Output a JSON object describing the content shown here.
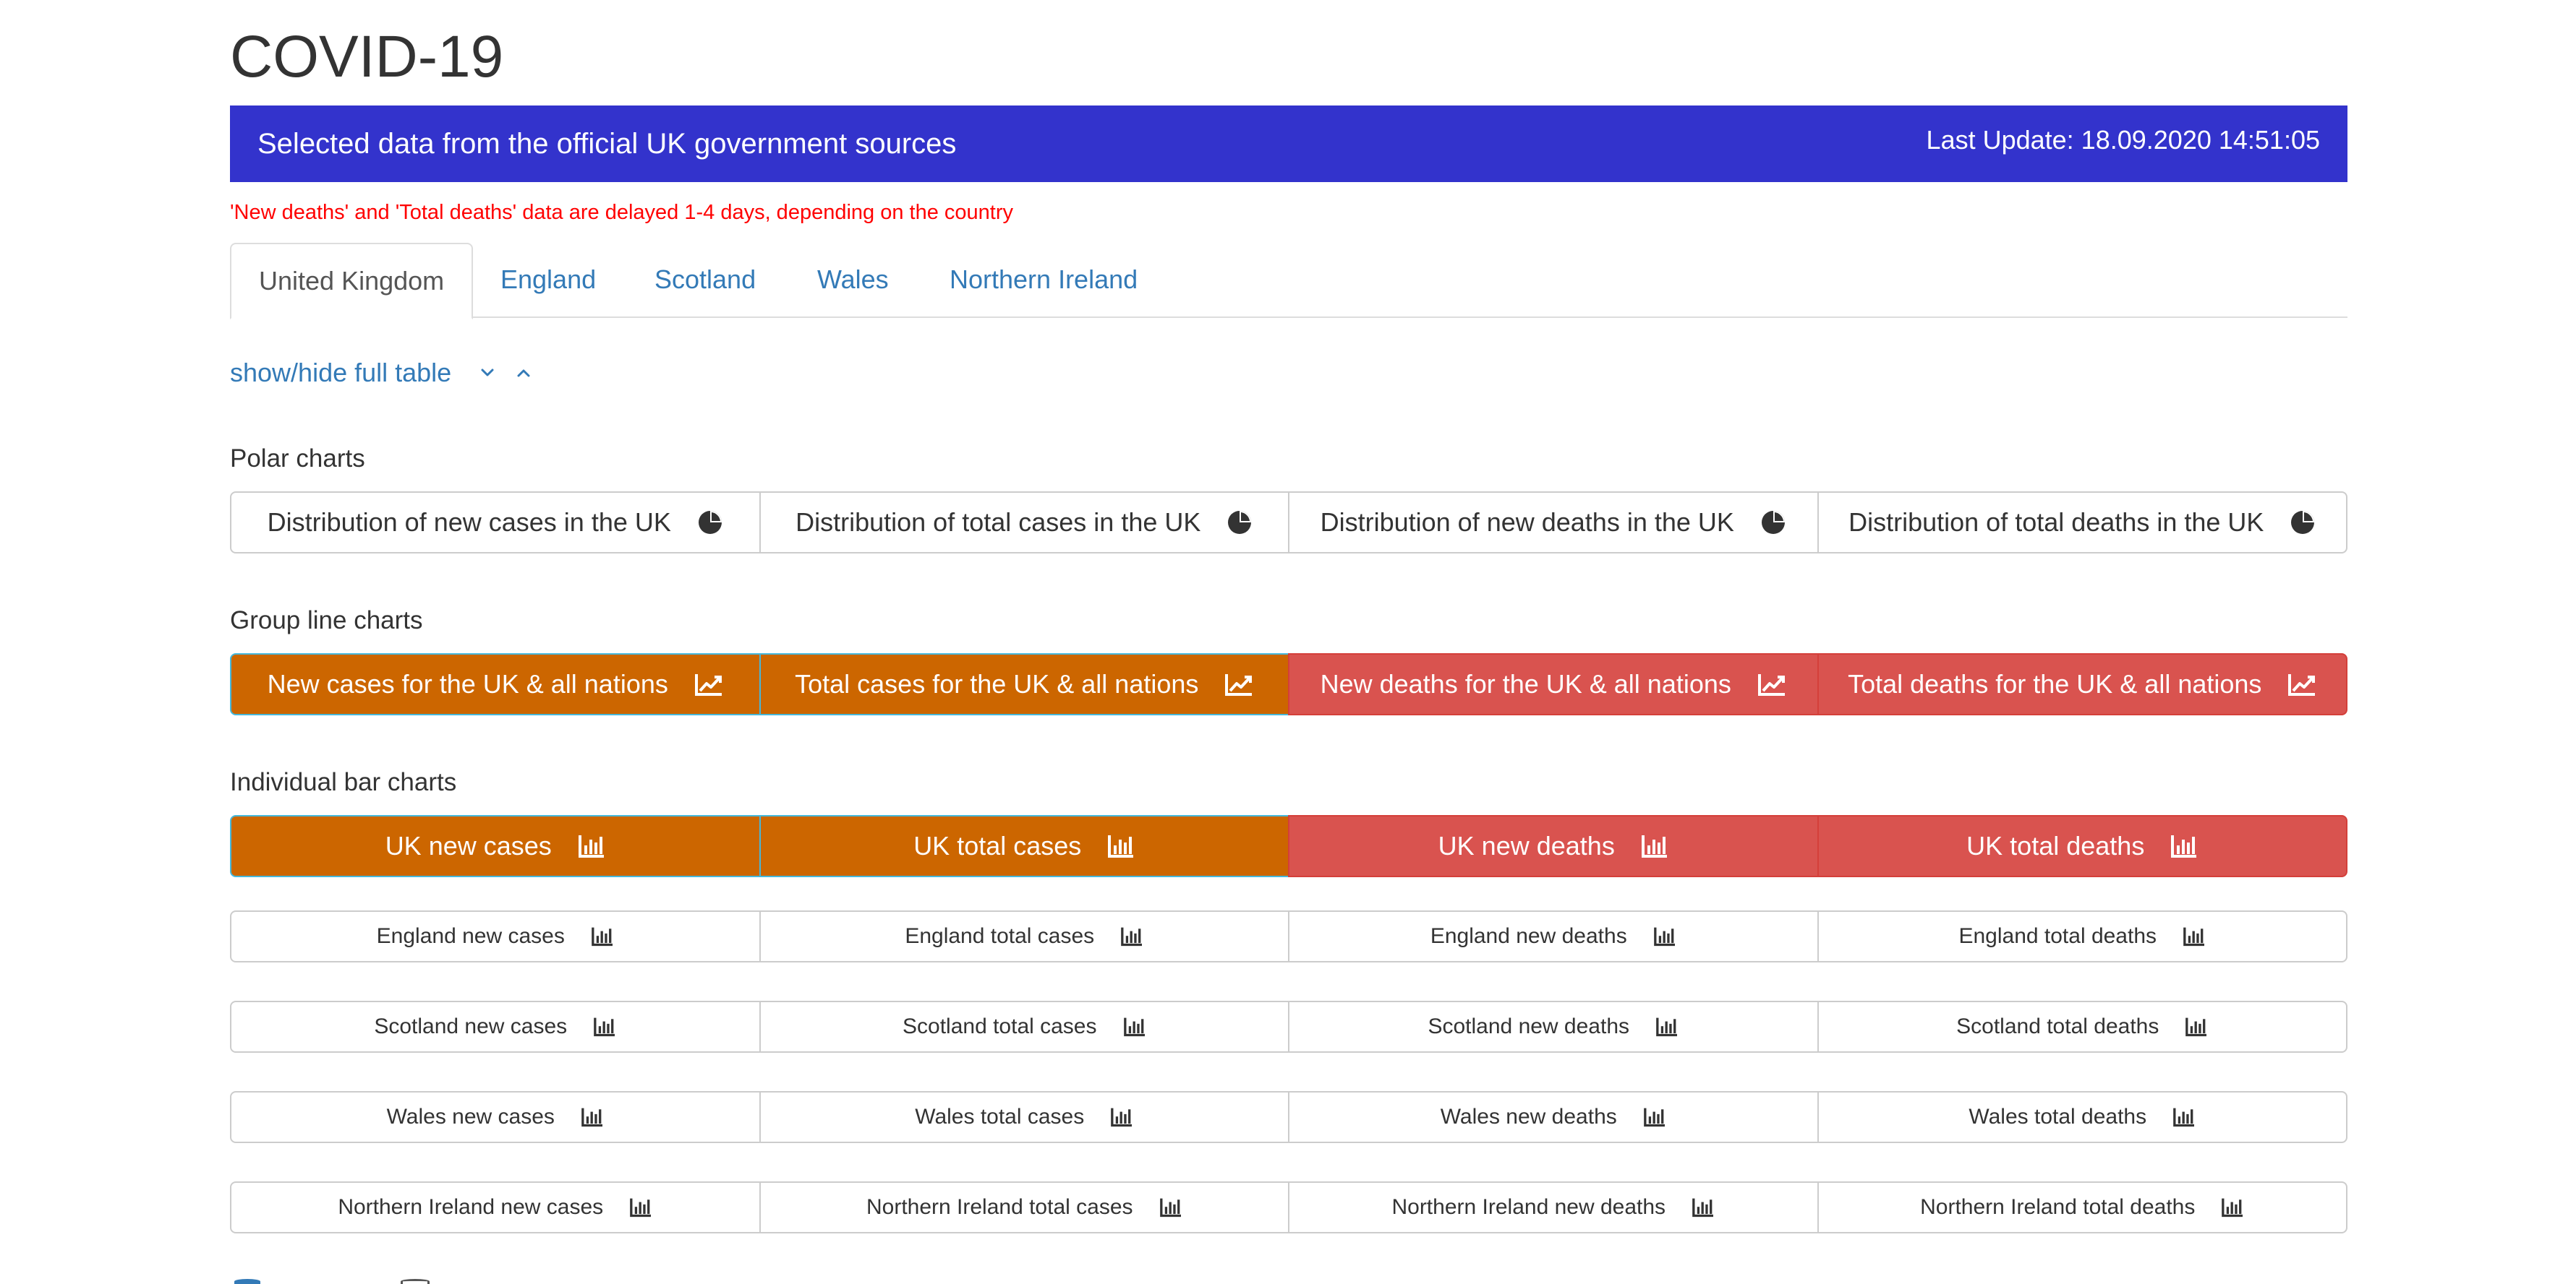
{
  "page": {
    "title": "COVID-19"
  },
  "banner": {
    "text": "Selected data from the official UK government sources",
    "last_update": "Last Update: 18.09.2020 14:51:05",
    "color": "#3333cc"
  },
  "notice": "'New deaths' and 'Total deaths' data are delayed 1-4 days, depending on the country",
  "tabs": [
    {
      "label": "United Kingdom",
      "active": true
    },
    {
      "label": "England",
      "active": false
    },
    {
      "label": "Scotland",
      "active": false
    },
    {
      "label": "Wales",
      "active": false
    },
    {
      "label": "Northern Ireland",
      "active": false
    }
  ],
  "toggle": {
    "label": "show/hide full table"
  },
  "polar": {
    "heading": "Polar charts",
    "buttons": [
      "Distribution of new cases in the UK",
      "Distribution of total cases in the UK",
      "Distribution of new deaths in the UK",
      "Distribution of total deaths in the UK"
    ]
  },
  "group_line": {
    "heading": "Group line charts",
    "buttons": [
      "New cases for the UK & all nations",
      "Total cases for the UK & all nations",
      "New deaths for the UK & all nations",
      "Total deaths for the UK & all nations"
    ]
  },
  "individual_bar": {
    "heading": "Individual bar charts",
    "uk": [
      "UK new cases",
      "UK total cases",
      "UK new deaths",
      "UK total deaths"
    ],
    "england": [
      "England new cases",
      "England total cases",
      "England new deaths",
      "England total deaths"
    ],
    "scotland": [
      "Scotland new cases",
      "Scotland total cases",
      "Scotland new deaths",
      "Scotland total deaths"
    ],
    "wales": [
      "Wales new cases",
      "Wales total cases",
      "Wales new deaths",
      "Wales total deaths"
    ],
    "northern_ireland": [
      "Northern Ireland new cases",
      "Northern Ireland total cases",
      "Northern Ireland new deaths",
      "Northern Ireland total deaths"
    ]
  },
  "colors": {
    "cases": "#cc6600",
    "deaths": "#d9534f",
    "link": "#337ab7",
    "notice": "#ff0000"
  }
}
